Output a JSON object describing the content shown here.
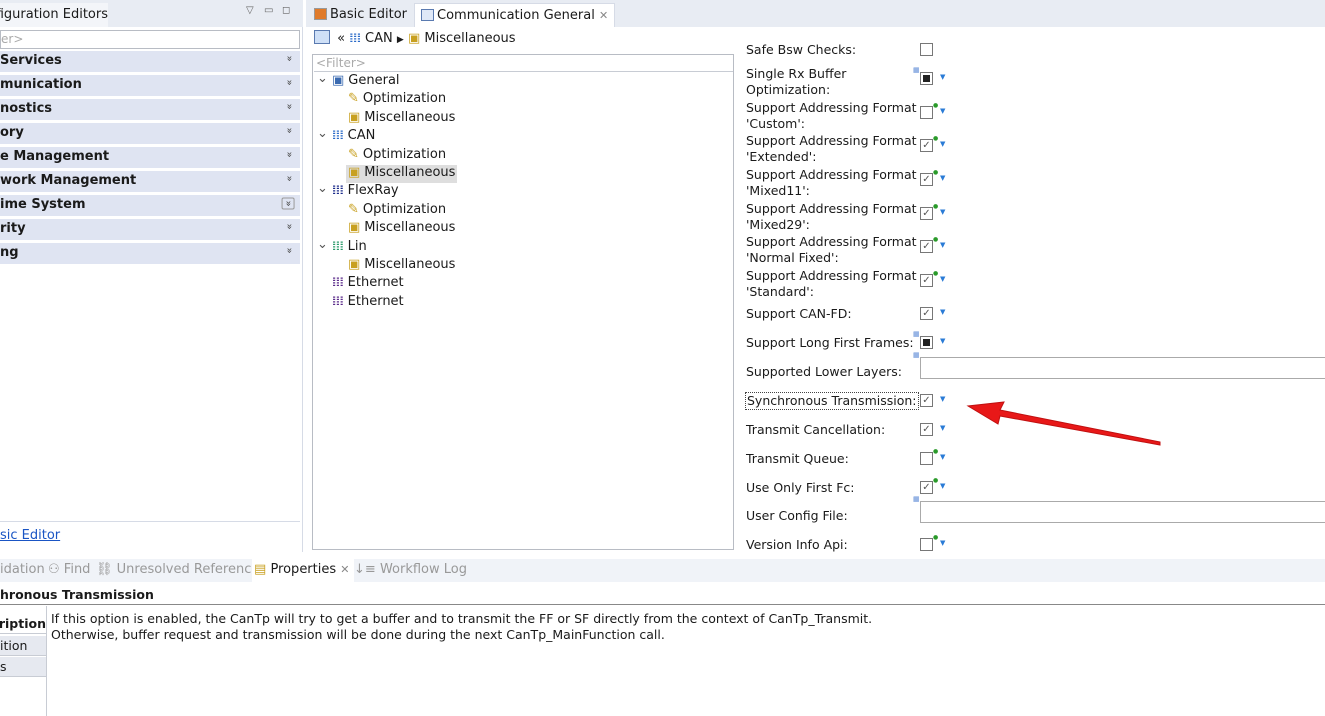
{
  "left_panel": {
    "tab": "Configuration Editors",
    "filter_placeholder": "<Filter>",
    "categories": [
      "Bsw Services",
      "Communication",
      "Diagnostics",
      "Memory",
      "Mode Management",
      "Network Management",
      "Runtime System",
      "Security",
      "Tracing"
    ],
    "partial_categories": [
      "Services",
      "munication",
      "nostics",
      "ory",
      "e Management",
      "work Management",
      "ime System",
      "rity",
      "ng"
    ],
    "tab_visible": "nfiguration Editors",
    "filter_visible": "er>",
    "link": "sic Editor"
  },
  "editor_tabs": [
    {
      "label": "Basic Editor",
      "active": false
    },
    {
      "label": "Communication General",
      "active": true
    }
  ],
  "breadcrumb": [
    "CAN",
    "Miscellaneous"
  ],
  "tree": {
    "filter_placeholder": "<Filter>",
    "items": [
      {
        "label": "General",
        "level": 0,
        "expanded": true,
        "icon": "general-icon"
      },
      {
        "label": "Optimization",
        "level": 1,
        "icon": "optimization-icon"
      },
      {
        "label": "Miscellaneous",
        "level": 1,
        "icon": "miscellaneous-icon"
      },
      {
        "label": "CAN",
        "level": 0,
        "expanded": true,
        "icon": "bus-icon",
        "color": "#2a6ac8"
      },
      {
        "label": "Optimization",
        "level": 1,
        "icon": "optimization-icon"
      },
      {
        "label": "Miscellaneous",
        "level": 1,
        "icon": "miscellaneous-icon",
        "selected": true
      },
      {
        "label": "FlexRay",
        "level": 0,
        "expanded": true,
        "icon": "bus-icon",
        "color": "#1a2a8a"
      },
      {
        "label": "Optimization",
        "level": 1,
        "icon": "optimization-icon"
      },
      {
        "label": "Miscellaneous",
        "level": 1,
        "icon": "miscellaneous-icon"
      },
      {
        "label": "Lin",
        "level": 0,
        "expanded": true,
        "icon": "bus-icon",
        "color": "#2a9a6a"
      },
      {
        "label": "Miscellaneous",
        "level": 1,
        "icon": "miscellaneous-icon"
      },
      {
        "label": "Ethernet",
        "level": 0,
        "icon": "bus-icon",
        "color": "#5a2a8a"
      },
      {
        "label": "Ethernet",
        "level": 0,
        "icon": "bus-icon",
        "color": "#5a2a8a"
      }
    ]
  },
  "settings": [
    {
      "label": "Safe Bsw Checks:",
      "type": "checkbox",
      "value": "unchecked"
    },
    {
      "label": "Single Rx Buffer\nOptimization:",
      "type": "checkbox",
      "value": "indeterminate"
    },
    {
      "label": "Support Addressing Format\n'Custom':",
      "type": "checkbox",
      "value": "unchecked",
      "modified": true
    },
    {
      "label": "Support Addressing Format\n'Extended':",
      "type": "checkbox",
      "value": "checked",
      "modified": true
    },
    {
      "label": "Support Addressing Format\n'Mixed11':",
      "type": "checkbox",
      "value": "checked",
      "modified": true
    },
    {
      "label": "Support Addressing Format\n'Mixed29':",
      "type": "checkbox",
      "value": "checked",
      "modified": true
    },
    {
      "label": "Support Addressing Format\n'Normal Fixed':",
      "type": "checkbox",
      "value": "checked",
      "modified": true
    },
    {
      "label": "Support Addressing Format\n'Standard':",
      "type": "checkbox",
      "value": "checked",
      "modified": true
    },
    {
      "label": "Support CAN-FD:",
      "type": "checkbox",
      "value": "checked"
    },
    {
      "label": "Support Long First Frames:",
      "type": "checkbox",
      "value": "indeterminate"
    },
    {
      "label": "Supported Lower Layers:",
      "type": "text",
      "value": ""
    },
    {
      "label": "Synchronous Transmission:",
      "type": "checkbox",
      "value": "checked",
      "focused": true
    },
    {
      "label": "Transmit Cancellation:",
      "type": "checkbox",
      "value": "checked"
    },
    {
      "label": "Transmit Queue:",
      "type": "checkbox",
      "value": "unchecked",
      "modified": true
    },
    {
      "label": "Use Only First Fc:",
      "type": "checkbox",
      "value": "checked",
      "modified": true
    },
    {
      "label": "User Config File:",
      "type": "text",
      "value": ""
    },
    {
      "label": "Version Info Api:",
      "type": "checkbox",
      "value": "unchecked",
      "modified": true
    }
  ],
  "bottom_tabs": [
    {
      "label": "idation",
      "active": false
    },
    {
      "label": "Find",
      "active": false
    },
    {
      "label": "Unresolved References",
      "active": false
    },
    {
      "label": "Properties",
      "active": true
    },
    {
      "label": "Workflow Log",
      "active": false
    }
  ],
  "properties": {
    "title": "hronous Transmission",
    "side_tabs": [
      "ription",
      "ition",
      "s"
    ],
    "description": [
      "If this option is enabled, the CanTp will try to get a buffer and to transmit the FF or SF directly from the context of CanTp_Transmit.",
      "Otherwise, buffer request and transmission will be done during the next CanTp_MainFunction call."
    ]
  },
  "colors": {
    "annotation_arrow": "#e81818",
    "category_bg": "#dfe4f2",
    "link": "#1a55c4"
  }
}
